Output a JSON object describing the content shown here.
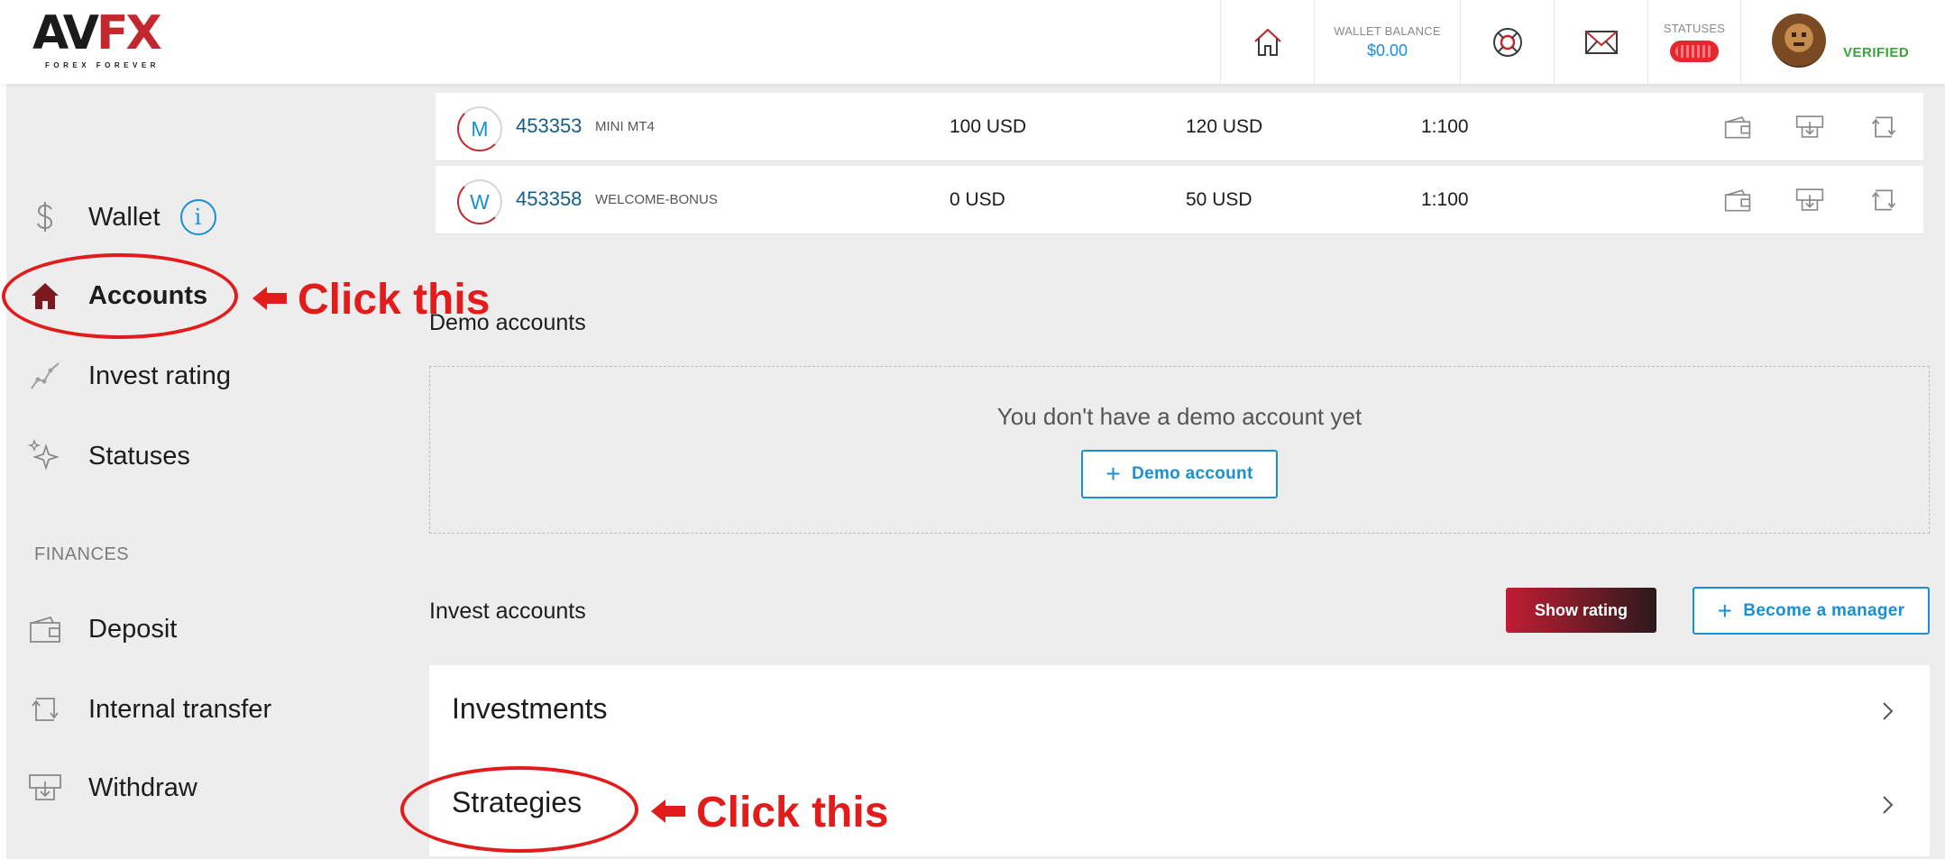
{
  "header": {
    "logo": {
      "name": "AVFX",
      "part1": "AV",
      "part2": "FX",
      "tagline": "FOREX FOREVER"
    },
    "wallet_label": "WALLET BALANCE",
    "wallet_balance": "$0.00",
    "statuses_label": "STATUSES",
    "verified_label": "VERIFIED",
    "icons": [
      "home-icon",
      "support-icon",
      "mail-icon"
    ]
  },
  "sidebar": {
    "items": [
      {
        "label": "Wallet",
        "icon": "dollar-icon"
      },
      {
        "label": "Accounts",
        "icon": "home-icon"
      },
      {
        "label": "Invest rating",
        "icon": "chart-line-icon"
      },
      {
        "label": "Statuses",
        "icon": "sparkle-icon"
      }
    ],
    "finances_title": "FINANCES",
    "finance_items": [
      {
        "label": "Deposit",
        "icon": "wallet-icon"
      },
      {
        "label": "Internal transfer",
        "icon": "transfer-icon"
      },
      {
        "label": "Withdraw",
        "icon": "withdraw-icon"
      }
    ]
  },
  "accounts": {
    "rows": [
      {
        "badge": "M",
        "number": "453353",
        "type": "MINI MT4",
        "balance": "100 USD",
        "equity": "120 USD",
        "leverage": "1:100"
      },
      {
        "badge": "W",
        "number": "453358",
        "type": "WELCOME-BONUS",
        "balance": "0 USD",
        "equity": "50 USD",
        "leverage": "1:100"
      }
    ]
  },
  "demo": {
    "title": "Demo accounts",
    "empty_message": "You don't have a demo account yet",
    "button_label": "Demo account"
  },
  "invest": {
    "title": "Invest accounts",
    "show_rating": "Show rating",
    "become_manager": "Become a manager",
    "items": [
      "Investments",
      "Strategies"
    ]
  },
  "annotations": {
    "arrow_text": "Click this"
  },
  "colors": {
    "brand_red": "#c4282f",
    "accent_blue": "#1a8fd4",
    "verified_green": "#3aa43a",
    "annotation_red": "#e21b1b"
  }
}
